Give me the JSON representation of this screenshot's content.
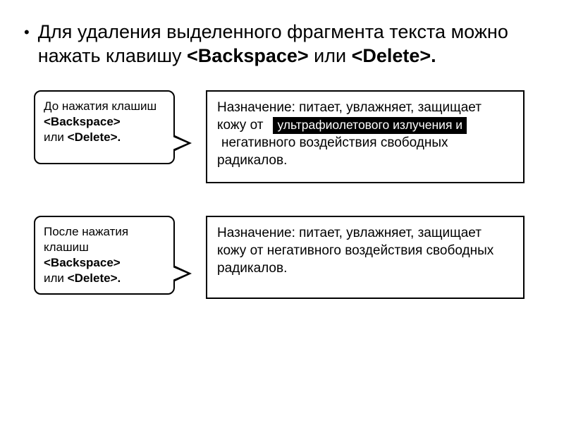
{
  "bullet": "•",
  "headline_plain1": "Для удаления выделенного фрагмента текста можно нажать клавишу ",
  "headline_bold1": "<Backspace>",
  "headline_plain2": " или ",
  "headline_bold2": "<Delete>.",
  "speech1_line1": "До нажатия клашиш",
  "speech1_bold1": "<Backspace>",
  "speech1_line2": " или ",
  "speech1_bold2": "<Delete>.",
  "box1_before": "Назначение: питает, увлажняет, защищает кожу от",
  "box1_highlight": "ультрафиолетового излучения и",
  "box1_after": "негативного воздействия свободных радикалов.",
  "speech2_line1": "После нажатия клашиш",
  "speech2_bold1": "<Backspace>",
  "speech2_line2": " или ",
  "speech2_bold2": "<Delete>.",
  "box2_text": "Назначение: питает, увлажняет, защищает кожу от негативного воздействия свободных радикалов."
}
